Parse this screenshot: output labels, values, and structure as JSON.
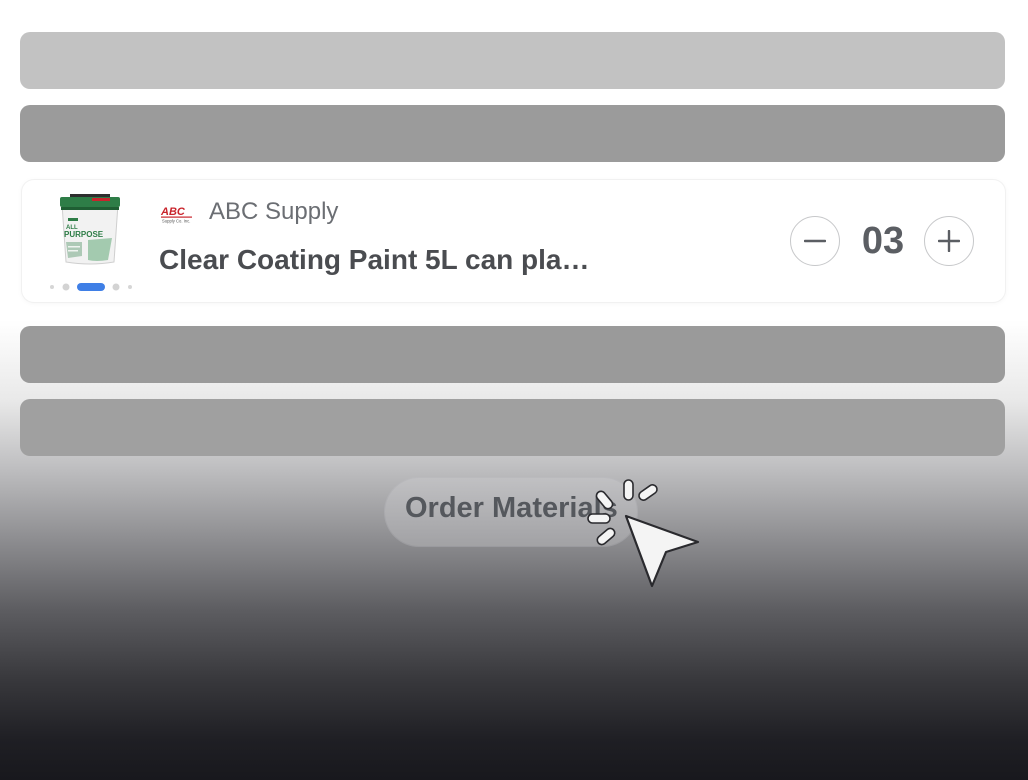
{
  "cart_item": {
    "supplier_logo": "ABC",
    "supplier_logo_sub": "Supply Co. Inc.",
    "supplier_name": "ABC Supply",
    "product_name": "Clear Coating Paint 5L can pla…",
    "quantity": "03",
    "image_carousel": {
      "count": 5,
      "active_index": 2
    },
    "product_image_text": "ALL PURPOSE"
  },
  "order_button_label": "Order Materials",
  "icons": {
    "decrement": "minus-icon",
    "increment": "plus-icon",
    "pointer": "click-cursor-icon",
    "logo": "abc-supply-logo"
  },
  "colors": {
    "accent": "#3f7fe6",
    "bucket_lid": "#2e7d47",
    "logo_red": "#c9242c"
  }
}
